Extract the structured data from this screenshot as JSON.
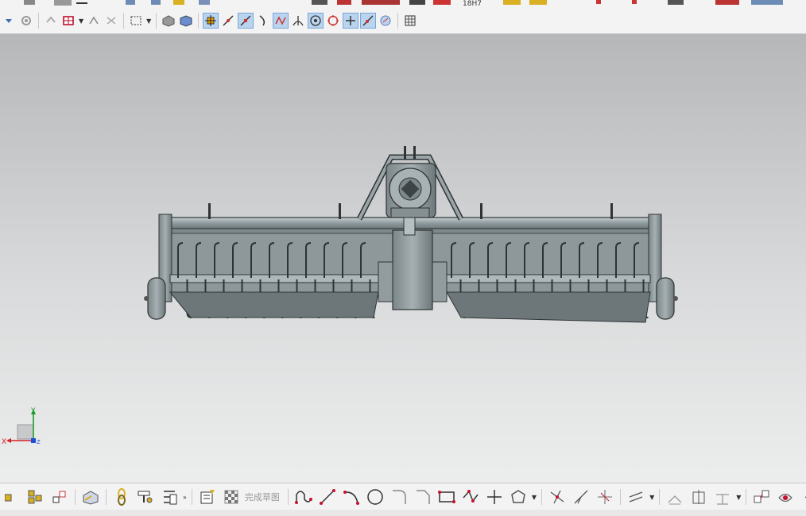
{
  "app": {
    "finish_sketch_label": "完成草图",
    "top_dropdown_value": "18H7"
  },
  "colors": {
    "viewport_top": "#b5b7b9",
    "viewport_bottom": "#eceded",
    "model_fill": "#9aa5a8",
    "model_stroke": "#2e3335",
    "axis_x": "#d21f1f",
    "axis_y": "#1f9d2a",
    "axis_z": "#1f4fd6",
    "sketch_red": "#c8102e"
  },
  "axis_triad": {
    "x_label": "X",
    "y_label": "Y",
    "z_label": "Z"
  },
  "top_toolbar_icons": [
    "dropdown-arrow-icon",
    "gear-icon",
    "undo-arrow-icon",
    "snap-grid-icon",
    "connect-icon",
    "connect-gray-icon",
    "rectangle-select-icon",
    "shaded-cube-icon",
    "solid-cube-icon",
    "snap-endpoint-icon",
    "snap-line-icon",
    "snap-tangent-icon",
    "snap-curve-icon",
    "snap-intersection-icon",
    "snap-perpendicular-icon",
    "snap-center-icon",
    "snap-quadrant-icon",
    "snap-point-icon",
    "snap-on-curve-icon",
    "snap-face-icon",
    "grid-icon"
  ],
  "bottom_toolbar_icons": [
    "component-icon",
    "assembly-icon",
    "constraint-icon",
    "view-box-icon",
    "chain-icon",
    "spanner-icon",
    "tree-icon",
    "sketch-icon",
    "finish-flag-icon",
    "profile-icon",
    "line-icon",
    "arc-icon",
    "circle-icon",
    "fillet-icon",
    "chamfer-icon",
    "rectangle-icon",
    "polyline-icon",
    "point-icon",
    "polygon-icon",
    "trim-icon",
    "extend-icon",
    "split-icon",
    "offset-icon",
    "mirror-icon",
    "pattern-icon",
    "dimension-icon",
    "constraint-tool-icon",
    "display-icon",
    "move-icon"
  ]
}
